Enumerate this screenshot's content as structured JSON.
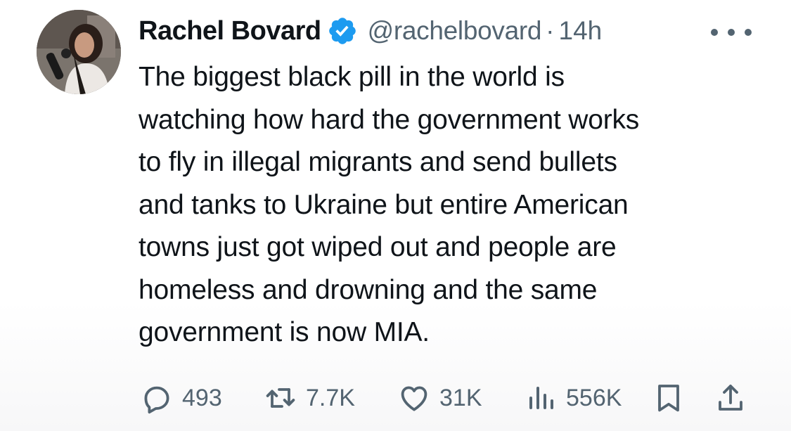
{
  "author": {
    "name": "Rachel Bovard",
    "handle": "@rachelbovard",
    "separator": "·",
    "time": "14h",
    "verified": true
  },
  "post": {
    "lines": [
      "The biggest black pill in the world is",
      "watching how hard the government works",
      "to fly in illegal migrants and send bullets",
      "and tanks to Ukraine but entire American",
      "towns just got wiped out and people are",
      "homeless and drowning and the same",
      "government is now MIA."
    ]
  },
  "actions": {
    "replies": "493",
    "reposts": "7.7K",
    "likes": "31K",
    "views": "556K"
  },
  "icons": {
    "more": "more-dots-icon",
    "verified": "verified-badge-icon",
    "reply": "reply-icon",
    "repost": "repost-icon",
    "like": "heart-icon",
    "views": "views-chart-icon",
    "bookmark": "bookmark-icon",
    "share": "share-icon"
  },
  "colors": {
    "text": "#0f1419",
    "secondary": "#536471",
    "verified": "#1d9bf0"
  }
}
